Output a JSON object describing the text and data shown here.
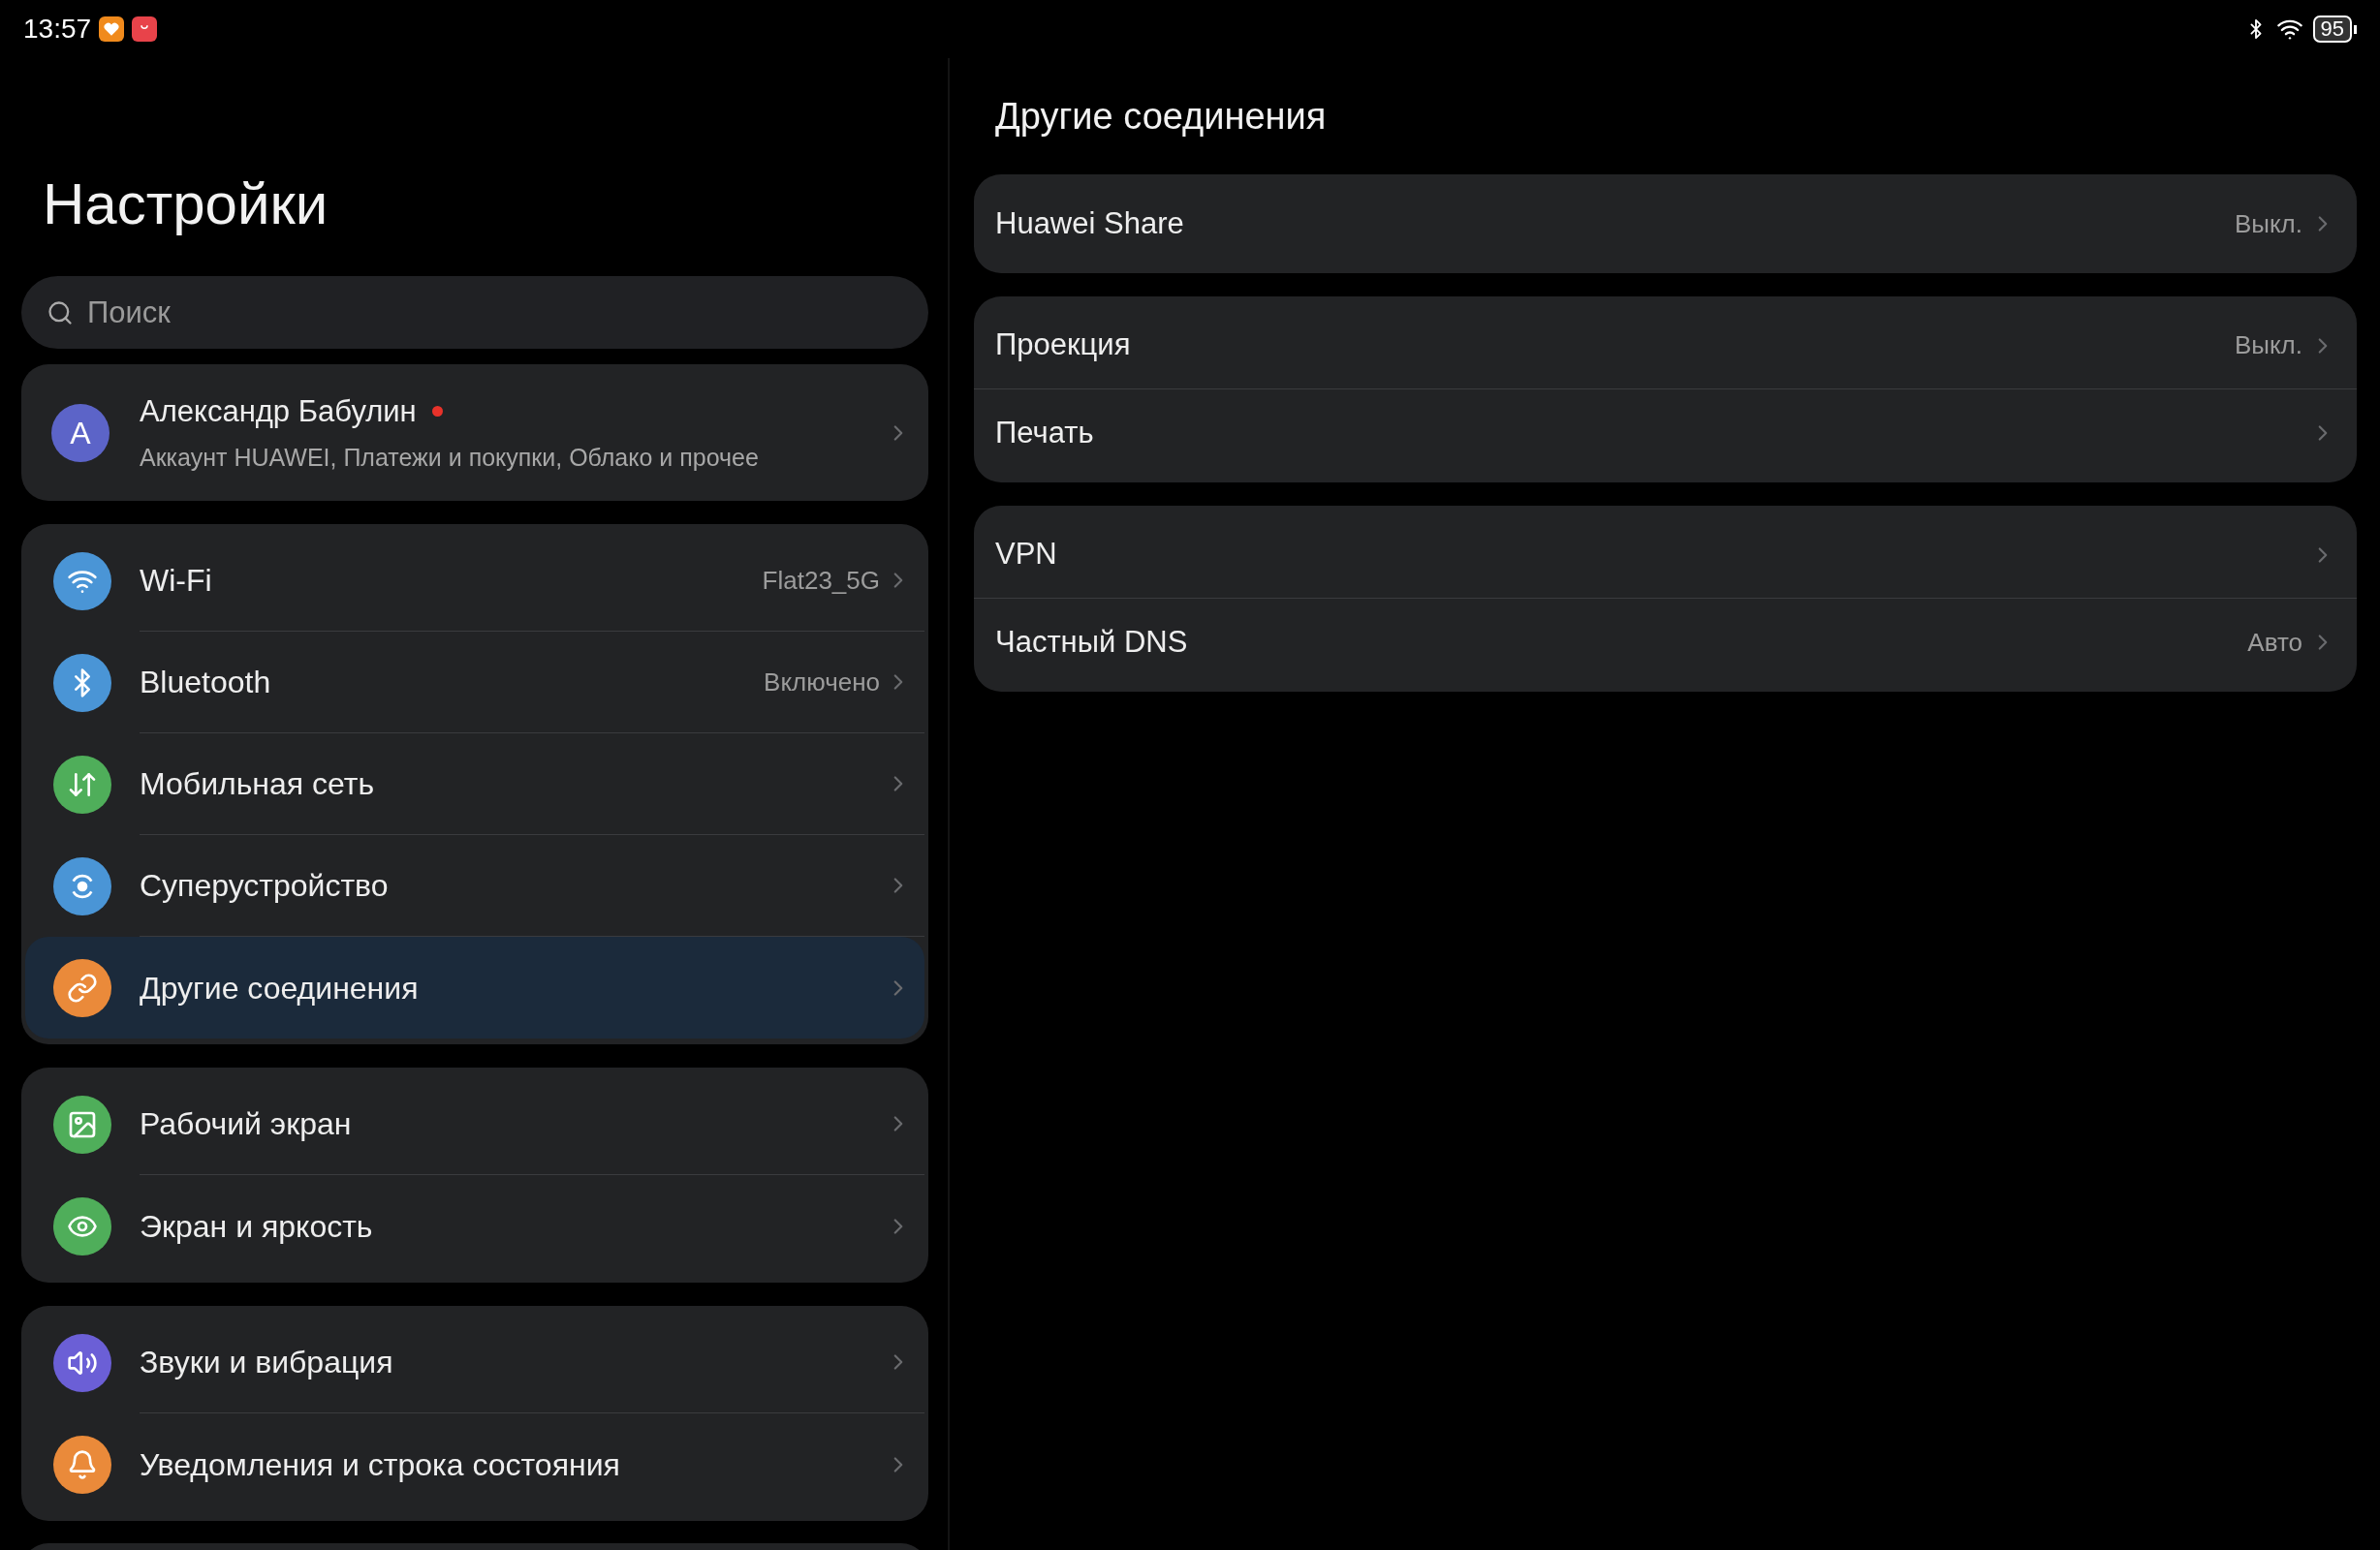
{
  "status_bar": {
    "time": "13:57",
    "battery": "95"
  },
  "sidebar": {
    "title": "Настройки",
    "search": {
      "placeholder": "Поиск"
    },
    "account": {
      "avatar_letter": "A",
      "name": "Александр Бабулин",
      "badge": true,
      "subtitle": "Аккаунт HUAWEI, Платежи и покупки, Облако и прочее"
    },
    "groups": [
      {
        "items": [
          {
            "label": "Wi-Fi",
            "value": "Flat23_5G",
            "selected": false
          },
          {
            "label": "Bluetooth",
            "value": "Включено",
            "selected": false
          },
          {
            "label": "Мобильная сеть",
            "selected": false
          },
          {
            "label": "Суперустройство",
            "selected": false
          },
          {
            "label": "Другие соединения",
            "selected": true
          }
        ]
      },
      {
        "items": [
          {
            "label": "Рабочий экран",
            "selected": false
          },
          {
            "label": "Экран и яркость",
            "selected": false
          }
        ]
      },
      {
        "items": [
          {
            "label": "Звуки и вибрация",
            "selected": false
          },
          {
            "label": "Уведомления и строка состояния",
            "selected": false
          }
        ]
      }
    ]
  },
  "detail": {
    "title": "Другие соединения",
    "groups": [
      {
        "items": [
          {
            "label": "Huawei Share",
            "value": "Выкл."
          }
        ]
      },
      {
        "items": [
          {
            "label": "Проекция",
            "value": "Выкл."
          },
          {
            "label": "Печать"
          }
        ]
      },
      {
        "items": [
          {
            "label": "VPN"
          },
          {
            "label": "Частный DNS",
            "value": "Авто"
          }
        ]
      }
    ]
  }
}
